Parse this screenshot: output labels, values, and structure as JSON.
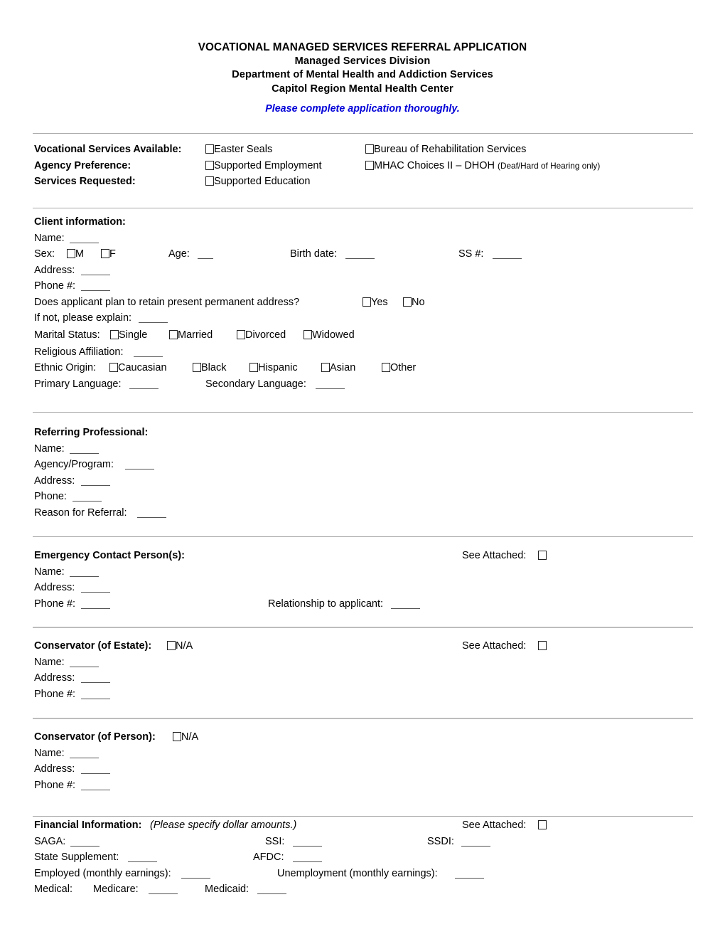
{
  "document": {
    "header": {
      "title": "VOCATIONAL MANAGED SERVICES REFERRAL APPLICATION",
      "line2": "Managed Services Division",
      "line3": "Department of Mental Health and Addiction Services",
      "line4": "Capitol Region Mental Health Center",
      "note": "Please complete application thoroughly.",
      "note_color": "#0000d8"
    },
    "services": {
      "label_services_available": "Vocational Services Available:",
      "label_agency_preference": "Agency Preference:",
      "label_services_requested": "Services Requested:",
      "options_col1": [
        "Easter Seals",
        "Supported Employment",
        "Supported Education"
      ],
      "options_col2": [
        "Bureau of Rehabilitation Services",
        "MHAC Choices II – DHOH"
      ],
      "dhoh_qualifier": "(Deaf/Hard of Hearing only)"
    },
    "client": {
      "heading": "Client information:",
      "name_label": "Name:",
      "sex_label": "Sex:",
      "sex_options": [
        "M",
        "F"
      ],
      "age_label": "Age:",
      "birth_date_label": "Birth date:",
      "ss_label": "SS #:",
      "address_label": "Address:",
      "phone_label": "Phone #:",
      "retain_address_question": "Does applicant plan to retain present permanent address?",
      "retain_options": [
        "Yes",
        "No"
      ],
      "if_not_label": "If not, please explain:",
      "marital_label": "Marital Status:",
      "marital_options": [
        "Single",
        "Married",
        "Divorced",
        "Widowed"
      ],
      "religious_label": "Religious Affiliation:",
      "ethnic_label": "Ethnic Origin:",
      "ethnic_options": [
        "Caucasian",
        "Black",
        "Hispanic",
        "Asian",
        "Other"
      ],
      "primary_language_label": "Primary Language:",
      "secondary_language_label": "Secondary Language:"
    },
    "referring": {
      "heading": "Referring Professional:",
      "name_label": "Name:",
      "agency_label": "Agency/Program:",
      "address_label": "Address:",
      "phone_label": "Phone:",
      "reason_label": "Reason for Referral:"
    },
    "emergency": {
      "heading": "Emergency Contact Person(s):",
      "see_attached_label": "See Attached:",
      "name_label": "Name:",
      "address_label": "Address:",
      "phone_label": "Phone #:",
      "relationship_label": "Relationship to applicant:"
    },
    "conservator_estate": {
      "heading": "Conservator (of Estate):",
      "na_label": "N/A",
      "see_attached_label": "See Attached:",
      "name_label": "Name:",
      "address_label": "Address:",
      "phone_label": "Phone #:"
    },
    "conservator_person": {
      "heading": "Conservator (of Person):",
      "na_label": "N/A",
      "name_label": "Name:",
      "address_label": "Address:",
      "phone_label": "Phone #:"
    },
    "financial": {
      "heading": "Financial Information:",
      "heading_note": "(Please specify dollar amounts.)",
      "see_attached_label": "See Attached:",
      "saga_label": "SAGA:",
      "ssi_label": "SSI:",
      "ssdi_label": "SSDI:",
      "state_supplement_label": "State Supplement:",
      "afdc_label": "AFDC:",
      "employed_label": "Employed (monthly earnings):",
      "unemployment_label": "Unemployment (monthly earnings):",
      "medical_label": "Medical:",
      "medicare_label": "Medicare:",
      "medicaid_label": "Medicaid:"
    }
  }
}
